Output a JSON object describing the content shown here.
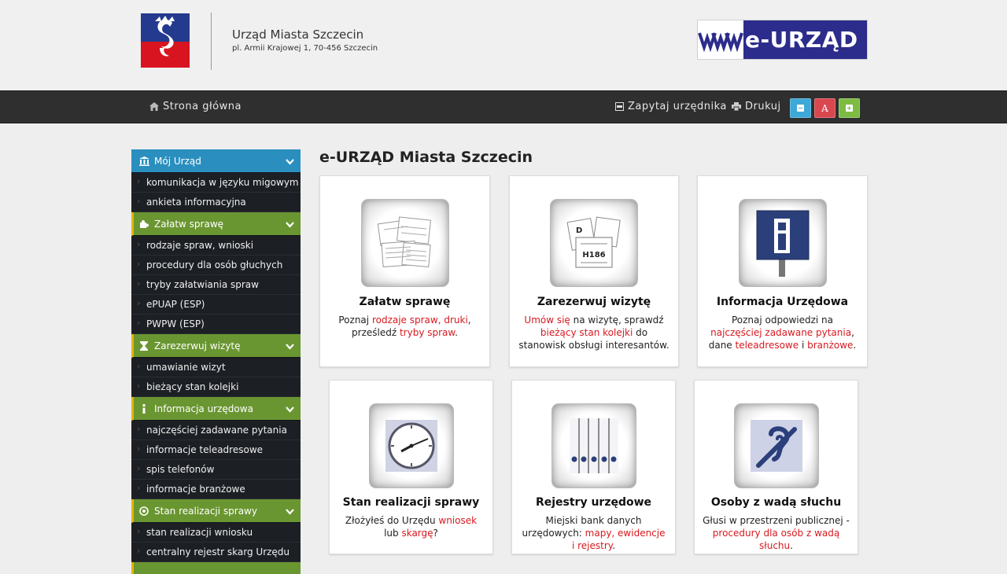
{
  "header": {
    "office_name": "Urząd Miasta Szczecin",
    "office_address": "pl. Armii Krajowej 1, 70-456 Szczecin",
    "logo_text": "e-URZĄD"
  },
  "nav": {
    "home": "Strona główna",
    "ask": "Zapytaj urzędnika",
    "print": "Drukuj",
    "font_button": "A"
  },
  "sidebar": {
    "sections": [
      {
        "label": "Mój Urząd",
        "icon": "bank-icon",
        "items": [
          "komunikacja w języku migowym",
          "ankieta informacyjna"
        ]
      },
      {
        "label": "Załatw sprawę",
        "icon": "puzzle-icon",
        "items": [
          "rodzaje spraw, wnioski",
          "procedury dla osób głuchych",
          "tryby załatwiania spraw",
          "ePUAP (ESP)",
          "PWPW (ESP)"
        ]
      },
      {
        "label": "Zarezerwuj wizytę",
        "icon": "hourglass-icon",
        "items": [
          "umawianie wizyt",
          "bieżący stan kolejki"
        ]
      },
      {
        "label": "Informacja urzędowa",
        "icon": "info-icon",
        "items": [
          "najczęściej zadawane pytania",
          "informacje teleadresowe",
          "spis telefonów",
          "informacje branżowe"
        ]
      },
      {
        "label": "Stan realizacji sprawy",
        "icon": "circle-dot-icon",
        "items": [
          "stan realizacji wniosku",
          "centralny rejestr skarg Urzędu"
        ]
      }
    ]
  },
  "main": {
    "title": "e-URZĄD Miasta Szczecin",
    "cards": [
      {
        "title": "Załatw sprawę",
        "icon": "documents-icon",
        "desc": [
          {
            "t": "Poznaj "
          },
          {
            "t": "rodzaje spraw, druki",
            "link": true
          },
          {
            "t": ", prześledź "
          },
          {
            "t": "tryby spraw",
            "link": true
          },
          {
            "t": "."
          }
        ]
      },
      {
        "title": "Zarezerwuj wizytę",
        "icon": "queue-tickets-icon",
        "desc": [
          {
            "t": "Umów się",
            "link": true
          },
          {
            "t": " na wizytę, sprawdź "
          },
          {
            "t": "bieżący stan kolejki",
            "link": true
          },
          {
            "t": " do stanowisk obsługi interesantów."
          }
        ]
      },
      {
        "title": "Informacja Urzędowa",
        "icon": "info-sign-icon",
        "desc": [
          {
            "t": "Poznaj odpowiedzi na "
          },
          {
            "t": "najczęściej zadawane pytania",
            "link": true
          },
          {
            "t": ", dane "
          },
          {
            "t": "teleadresowe",
            "link": true
          },
          {
            "t": " i "
          },
          {
            "t": "branżowe",
            "link": true
          },
          {
            "t": "."
          }
        ]
      },
      {
        "title": "Stan realizacji sprawy",
        "icon": "clock-icon",
        "desc": [
          {
            "t": "Złożyłeś do Urzędu "
          },
          {
            "t": "wniosek",
            "link": true
          },
          {
            "t": " lub "
          },
          {
            "t": "skargę",
            "link": true
          },
          {
            "t": "?"
          }
        ]
      },
      {
        "title": "Rejestry urzędowe",
        "icon": "binders-icon",
        "desc": [
          {
            "t": "Miejski bank danych urzędowych: "
          },
          {
            "t": "mapy, ewidencje i rejestry",
            "link": true
          },
          {
            "t": "."
          }
        ]
      },
      {
        "title": "Osoby z wadą słuchu",
        "icon": "hearing-impaired-icon",
        "desc": [
          {
            "t": "Głusi w przestrzeni publicznej - "
          },
          {
            "t": "procedury dla osób z wadą słuchu",
            "link": true
          },
          {
            "t": "."
          }
        ]
      }
    ]
  },
  "colors": {
    "sidebar_blue": "#2a8fbf",
    "sidebar_green": "#6a9631",
    "accent_yellow": "#e9b400",
    "link_red": "#d71920",
    "navbar": "#2f2f2f"
  }
}
